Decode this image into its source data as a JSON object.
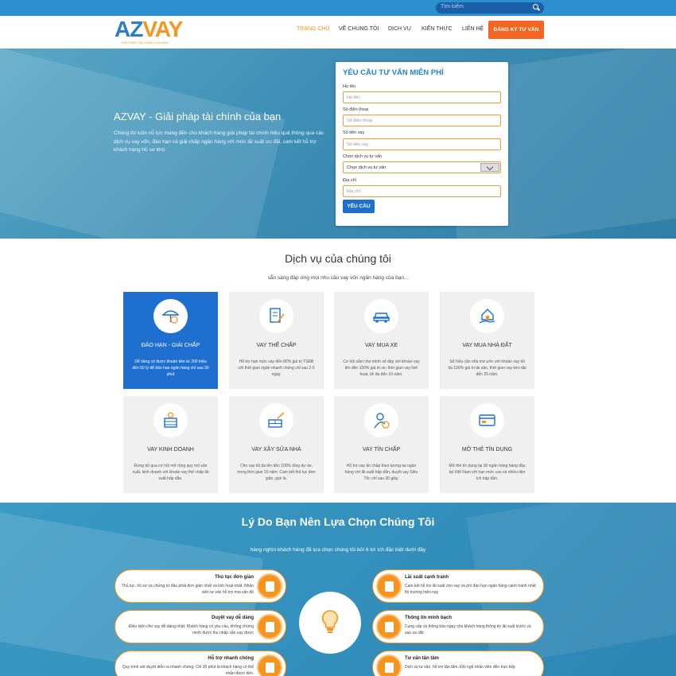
{
  "search": {
    "placeholder": "Tìm kiếm"
  },
  "logo": {
    "text_main": "AZ",
    "text_accent": "VAY",
    "tagline": "GIẢI PHÁP TÀI CHÍNH CỦA BẠN"
  },
  "nav": {
    "items": [
      "TRANG CHỦ",
      "VỀ CHÚNG TÔI",
      "DỊCH VỤ",
      "KIẾN THỨC",
      "LIÊN HỆ"
    ],
    "cta": "ĐĂNG KÝ TƯ VẤN"
  },
  "hero": {
    "title": "AZVAY - Giải pháp tài chính của bạn",
    "desc": "Chúng tôi luôn nỗ lực mang đến cho khách hàng giải pháp tài chính hiệu quả thông qua các dịch vụ vay vốn, đáo hạn và giải chấp ngân hàng với mức lãi suất ưu đãi, cam kết hỗ trợ khách hàng hồ sơ khó."
  },
  "form": {
    "title": "YÊU CẦU TƯ VẤN MIỄN PHÍ",
    "fields": [
      {
        "label": "Họ tên",
        "placeholder": "Họ tên"
      },
      {
        "label": "Số điện thoại",
        "placeholder": "Số điện thoại"
      },
      {
        "label": "Số tiền vay",
        "placeholder": "Số tiền vay"
      },
      {
        "label": "Chọn dịch vụ tư vấn",
        "placeholder": "Chọn dịch vụ tư vấn"
      },
      {
        "label": "Địa chỉ",
        "placeholder": "Địa chỉ"
      }
    ],
    "submit": "YÊU CẦU"
  },
  "services": {
    "title": "Dịch vụ của chúng tôi",
    "subtitle": "sẵn sàng đáp ứng mọi nhu cầu vay vốn ngân hàng của bạn...",
    "items": [
      {
        "title": "ĐÁO HẠN - GIẢI CHẤP",
        "desc": "Dễ dàng có được khoản tiền từ 200 triệu đến 50 tỷ để đáo hạn ngân hàng chỉ sau 30 phút",
        "icon": "umbrella-coin-icon"
      },
      {
        "title": "VAY THẾ CHẤP",
        "desc": "Hỗ trợ hạn mức vay đến 80% giá trị TSĐB với thời gian ngân nhanh chóng chỉ sau 2-5 ngày.",
        "icon": "document-pen-icon"
      },
      {
        "title": "VAY MUA XE",
        "desc": "Cơ hội sắm cho mình xế đẹp với khoản vay lên đến 100% giá trị xe, thời gian vay linh hoạt, tối đa đến 10 năm.",
        "icon": "car-icon"
      },
      {
        "title": "VAY MUA NHÀ ĐẤT",
        "desc": "Sở hữu căn nhà mơ ước với khoản vay tối đa 100% giá trị tài sản, thời gian vay kéo dài đến 25 năm.",
        "icon": "house-hand-icon"
      },
      {
        "title": "VAY KINH DOANH",
        "desc": "Đừng bỏ qua cơ hội mở rộng quy mô sản xuất, kinh doanh với khoản vay thế chấp lãi suất hấp dẫn.",
        "icon": "coin-stack-icon"
      },
      {
        "title": "VAY XÂY SỬA NHÀ",
        "desc": "Cho vay tối đa lên đến 100% tổng dự án, trong thời gian 15 năm. Cam kết thủ tục đơn giản, gọn lẹ.",
        "icon": "brick-trowel-icon"
      },
      {
        "title": "VAY TÍN CHẤP",
        "desc": "Hỗ trợ vay tín chấp theo lương tại ngân hàng với lãi suất hấp dẫn, duyệt vay Siêu Tốc chỉ sau 30 giây.",
        "icon": "person-money-icon"
      },
      {
        "title": "MỞ THẺ TÍN DỤNG",
        "desc": "Mở thẻ tín dụng tại 30 ngân hàng hàng đầu tại Việt Nam với hạn mức cao và nhiều tiện ích hấp dẫn.",
        "icon": "credit-card-icon"
      }
    ]
  },
  "why": {
    "title": "Lý Do Bạn Nên Lựa Chọn Chúng Tôi",
    "subtitle": "hàng nghìn khách hàng đã lựa chọn chúng tôi bởi 6 lợi ích đặc biệt dưới đây",
    "left": [
      {
        "title": "Thủ tục đơn giản",
        "desc": "Thủ tục, hồ sơ và chứng từ đầu phải đơn giản nhất và linh hoạt nhất. Nhân viên tư vấn hỗ trợ mọi vấn đề"
      },
      {
        "title": "Duyệt vay dễ dàng",
        "desc": "Điều kiện cho vay dễ dàng nhất. Khách hàng có yêu cầu, không chứng minh được thu nhập vẫn vay được"
      },
      {
        "title": "Hỗ trợ nhanh chóng",
        "desc": "Quy trình xét duyệt diễn ra nhanh chóng. Chỉ 30 phút là khách hàng có thể nhận được tiền."
      }
    ],
    "right": [
      {
        "title": "Lãi suất cạnh tranh",
        "desc": "Cam kết hỗ trợ lãi suất cho vay và phí đáo hạn ngân hàng cạnh tranh nhất thị trường hiện nay"
      },
      {
        "title": "Thông tin minh bạch",
        "desc": "Cung cấp và thông báo ngay cho khách hàng thông tin lãi suất trước và sau ưu đãi"
      },
      {
        "title": "Tư vấn tận tâm",
        "desc": "Dịch vụ tư vấn, hỗ trợ tận tâm. Đội ngũ nhân viên đến trực tiếp"
      }
    ]
  },
  "colors": {
    "primary": "#1e6fd0",
    "accent": "#f7941d",
    "cta": "#f26522"
  }
}
